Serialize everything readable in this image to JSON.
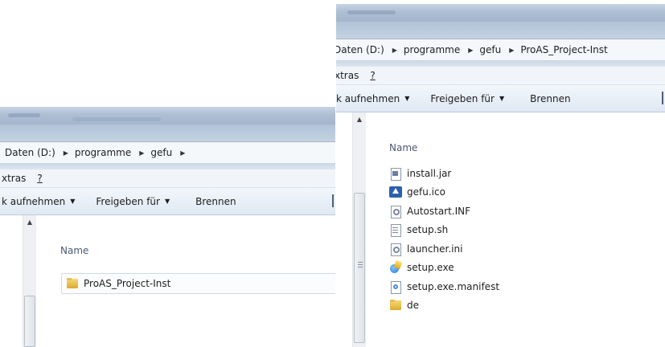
{
  "left_window": {
    "breadcrumb": [
      "Daten (D:)",
      "programme",
      "gefu"
    ],
    "menu": [
      "xtras",
      "?"
    ],
    "toolbar": [
      "k aufnehmen",
      "Freigeben für",
      "Brennen"
    ],
    "column_header": "Name",
    "items": [
      {
        "name": "ProAS_Project-Inst",
        "icon": "folder-icon"
      }
    ]
  },
  "right_window": {
    "breadcrumb": [
      "Daten (D:)",
      "programme",
      "gefu",
      "ProAS_Project-Inst"
    ],
    "menu": [
      "xtras",
      "?"
    ],
    "toolbar": [
      "k aufnehmen",
      "Freigeben für",
      "Brennen"
    ],
    "column_header": "Name",
    "items": [
      {
        "name": "install.jar",
        "icon": "jar-file-icon"
      },
      {
        "name": "gefu.ico",
        "icon": "gefu-app-icon"
      },
      {
        "name": "Autostart.INF",
        "icon": "settings-file-icon"
      },
      {
        "name": "setup.sh",
        "icon": "text-file-icon"
      },
      {
        "name": "launcher.ini",
        "icon": "settings-file-icon"
      },
      {
        "name": "setup.exe",
        "icon": "installer-icon"
      },
      {
        "name": "setup.exe.manifest",
        "icon": "manifest-file-icon"
      },
      {
        "name": "de",
        "icon": "folder-icon"
      }
    ]
  }
}
